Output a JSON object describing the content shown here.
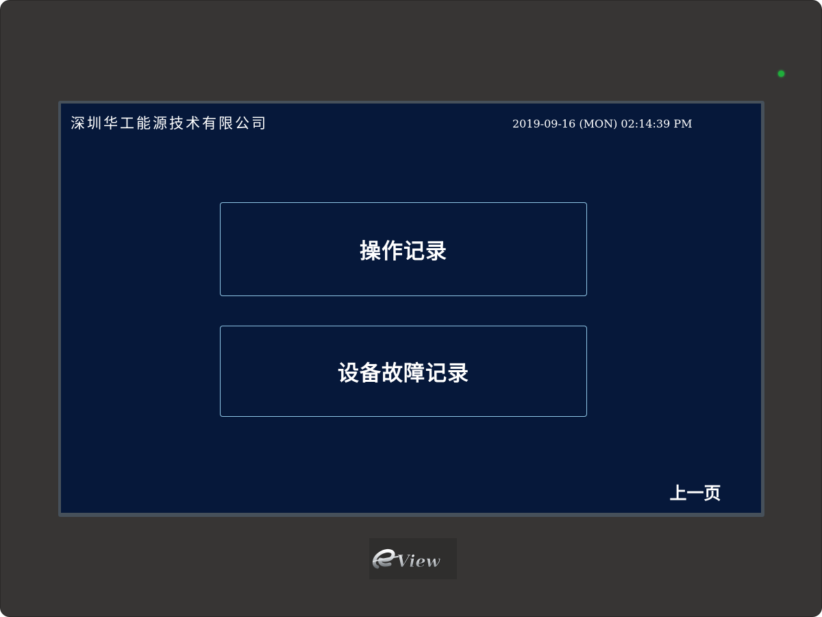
{
  "header": {
    "company_name": "深圳华工能源技术有限公司",
    "datetime": "2019-09-16 (MON) 02:14:39 PM"
  },
  "menu": {
    "operation_log_label": "操作记录",
    "device_fault_log_label": "设备故障记录"
  },
  "nav": {
    "previous_page_label": "上一页"
  },
  "device": {
    "brand_logo_text": "eView",
    "status_led_color": "#1fae3b"
  },
  "colors": {
    "screen_background": "#06183a",
    "button_border": "#8fc6e6",
    "bezel": "#373534"
  }
}
